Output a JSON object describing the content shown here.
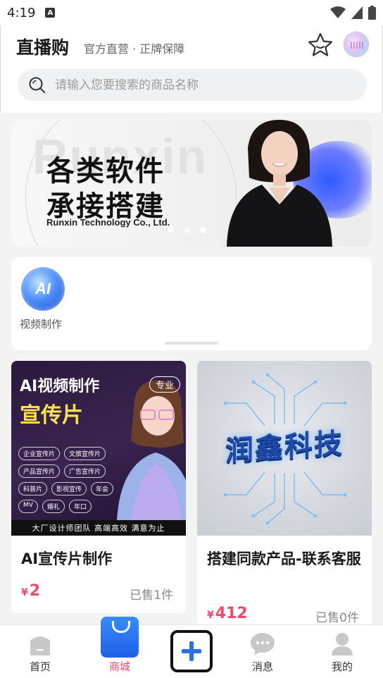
{
  "status_bar": {
    "time": "4:19",
    "a_badge": "A"
  },
  "header": {
    "title": "直播购",
    "subtitle": "官方直营 · 正牌保障"
  },
  "search": {
    "placeholder": "请输入您要搜索的商品名称"
  },
  "banner": {
    "watermark": "Runxin",
    "line1": "各类软件",
    "line2": "承接搭建",
    "company": "Runxin Technology Co., Ltd.",
    "dots": 3,
    "active_dot": 2
  },
  "categories": [
    {
      "icon_text": "AI",
      "label": "视频制作"
    }
  ],
  "products": [
    {
      "image": {
        "headline": "AI视频制作",
        "subhead": "宣传片",
        "tag": "专业",
        "chips": [
          "企业宣传片",
          "文旅宣传片",
          "产品宣传片",
          "广告宣传片",
          "科普片",
          "影视宣传",
          "年会",
          "MV",
          "婚礼",
          "年口"
        ],
        "band": "大厂设计师团队  高端高效  满意为止"
      },
      "title": "AI宣传片制作",
      "currency": "¥",
      "price": "2",
      "sold": "已售1件"
    },
    {
      "image": {
        "headline": "润鑫科技"
      },
      "title": "搭建同款产品-联系客服",
      "currency": "¥",
      "price": "412",
      "sold": "已售0件"
    }
  ],
  "bottom_nav": {
    "home": "首页",
    "mall": "商城",
    "messages": "消息",
    "me": "我的"
  },
  "colors": {
    "accent_pink": "#f04a6a",
    "mall_blue": "#1d5fe6",
    "background": "#f3f3f4"
  }
}
